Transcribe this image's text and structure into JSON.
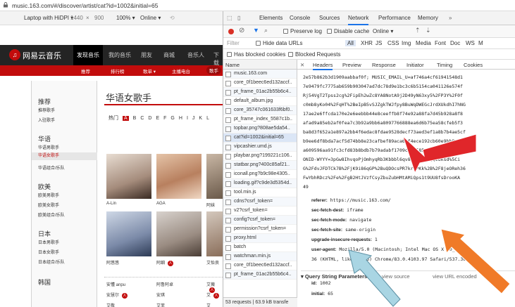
{
  "address_bar": {
    "url": "music.163.com/#/discover/artist/cat?id=1002&initial=65"
  },
  "device_toolbar": {
    "device": "Laptop with HiDPI ▾",
    "width": "1440",
    "height": "900",
    "zoom": "100% ▾",
    "network": "Online ▾"
  },
  "site": {
    "logo_text": "网易云音乐",
    "nav": [
      "发现音乐",
      "我的音乐",
      "朋友",
      "商城",
      "音乐人",
      "下载"
    ],
    "subnav": [
      "推荐",
      "排行榜",
      "歌单 ▾",
      "主播电台",
      "歌手"
    ],
    "sidebar": [
      {
        "heading": "推荐",
        "items": [
          "推荐歌手",
          "入驻歌手"
        ]
      },
      {
        "heading": "华语",
        "items": [
          "华语男歌手",
          "华语女歌手",
          "华语组合/乐队"
        ]
      },
      {
        "heading": "欧美",
        "items": [
          "欧美男歌手",
          "欧美女歌手",
          "欧美组合/乐队"
        ]
      },
      {
        "heading": "日本",
        "items": [
          "日本男歌手",
          "日本女歌手",
          "日本组合/乐队"
        ]
      },
      {
        "heading": "韩国",
        "items": []
      }
    ],
    "page_title": "华语女歌手",
    "letters": [
      "热门",
      "A",
      "B",
      "C",
      "D",
      "E",
      "F",
      "G",
      "H",
      "I",
      "J",
      "K",
      "L"
    ],
    "artists_row1": [
      "A-Lin",
      "AGA",
      "阿妹"
    ],
    "artists_row2": [
      "阿悠悠",
      "阿细",
      "艾怡良"
    ],
    "text_list": [
      [
        "安懂 anpu",
        "阿鲁阿卓",
        "艾薇"
      ],
      [
        "安慧尔",
        "安琪",
        "艾"
      ],
      [
        "艾敬",
        "艾菲",
        "艾"
      ]
    ]
  },
  "devtools": {
    "tabs": [
      "Elements",
      "Console",
      "Sources",
      "Network",
      "Performance",
      "Memory"
    ],
    "active_tab": "Network",
    "preserve_log": "Preserve log",
    "disable_cache": "Disable cache",
    "throttle": "Online",
    "filter_placeholder": "Filter",
    "hide_data_urls": "Hide data URLs",
    "type_filters": [
      "All",
      "XHR",
      "JS",
      "CSS",
      "Img",
      "Media",
      "Font",
      "Doc",
      "WS",
      "M"
    ],
    "has_blocked_cookies": "Has blocked cookies",
    "blocked_requests": "Blocked Requests",
    "name_header": "Name",
    "requests": [
      "music.163.com",
      "core_0f1beec6ed132accf..",
      "pt_frame_01ac2b55b6c4..",
      "default_album.jpg",
      "core_35747c061633f6bf0..",
      "pt_frame_index_5587c1b..",
      "topbar.png?808ae5da54..",
      "cat?id=1002&initial=65",
      "vipcashier.umd.js",
      "playbar.png?199221c106..",
      "statbar.png?400c85af21..",
      "iconall.png?b9c98e4305..",
      "loading.gif?c9de3d5354d..",
      "tool.min.js",
      "cdns?csrf_token=",
      "v2?csrf_token=",
      "config?csrf_token=",
      "permission?csrf_token=",
      "proxy.html",
      "batch",
      "watchman.min.js",
      "core_0f1beec6ed132accf..",
      "pt_frame_01ac2b55b6c4.."
    ],
    "footer_requests": "53 requests",
    "footer_size": "63.9 kB transfe",
    "detail_tabs": [
      "Headers",
      "Preview",
      "Response",
      "Initiator",
      "Timing",
      "Cookies"
    ],
    "cookie_lines": [
      "2e57b862b3d1909aabbaf0f; MUSIC_EMAIL_U=af746a4cf61941548d1",
      "7e9479fc7775ab659b903047ad7dc78d9e1bc3c6b5154ca041126e574f",
      "Rj54VgT2Tpss2cg%2FipEh2wZc8YA8NotA9j2D49yN63xy5%2FP3Y%2F0f",
      "c0mb8yKo04%2FqHT%2BeIpB5vSJZgkTWJfpy8BuWqDWEGcJrdXUkdhI7hNG",
      "17ae2e6ffcda170e2e6eebbb44e8ceeffb8f74e92a88fa7d45b928a8f8",
      "afad9a85eb2af0fea7c3b92a9bb6a8097766888ea6d6b75ea58cfeb5f3",
      "ba8d3f652a1e897a2bb4f6edac8fdae9528decf73aed3ef1a8b7b4ae5cf",
      "b9ee6df8bda7acf5d74bb8e23cafbef89aca65f4ece192cb60e9bb8",
      "a609596aa91fc3cfd83b8bdb7b79adabf1709c8ba585eb43f5b882a8",
      "ONID-WYYY=3pGw8IhvqoPjOmhyqRb3Kbbbl6qv8%5CfAtDQQzOksd%5Ci",
      "G%2FdvJFDTCk7B%2FjK9i86qGP%2BuQDOcsPR7krZPKk%2B%2F8jeOReh36",
      "FwYbhRDcz%2Fe%2FgB2HtJVzfCsyZbuZubHMtAMiQps1t9UU8fsDrooKA",
      "49"
    ],
    "headers": [
      {
        "k": "referer:",
        "v": "https://music.163.com/"
      },
      {
        "k": "sec-fetch-dest:",
        "v": "iframe"
      },
      {
        "k": "sec-fetch-mode:",
        "v": "navigate"
      },
      {
        "k": "sec-fetch-site:",
        "v": "same-origin"
      },
      {
        "k": "upgrade-insecure-requests:",
        "v": "1"
      },
      {
        "k": "user-agent:",
        "v": "Mozilla/5.0 (Macintosh; Intel Mac OS X 10_14_6)"
      },
      {
        "k": "",
        "v": "36 (KHTML, like Gecko) Chrome/83.0.4103.97 Safari/537.36"
      }
    ],
    "qs_title": "Query String Parameters",
    "view_source": "view source",
    "view_url_encoded": "view URL encoded",
    "params": [
      {
        "k": "id:",
        "v": "1002"
      },
      {
        "k": "initial:",
        "v": "65"
      }
    ]
  },
  "colors": {
    "brand_red": "#c20c0c",
    "arrow_red": "#e0262a",
    "arrow_orange": "#f07a28",
    "arrow_blue": "#a9d5e3"
  }
}
